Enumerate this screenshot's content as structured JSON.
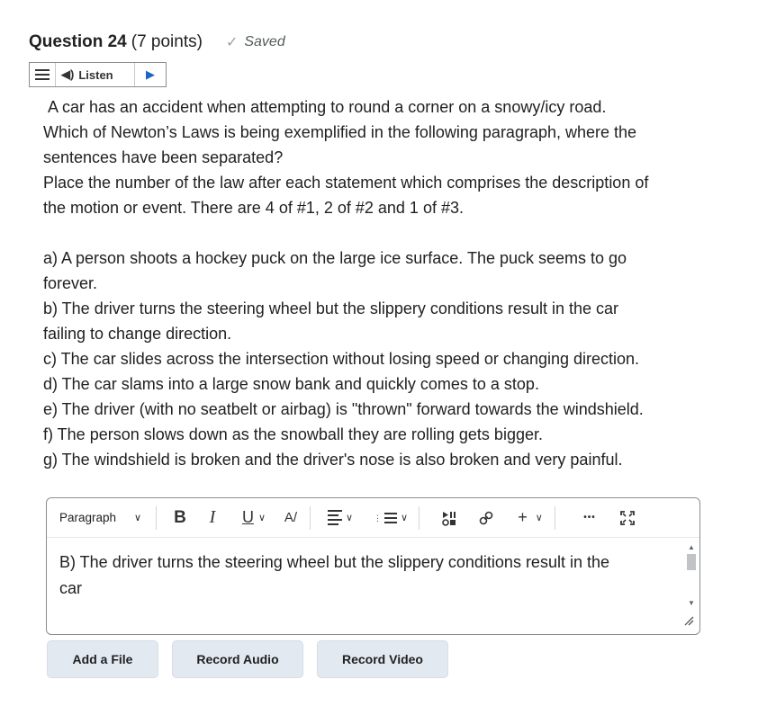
{
  "question": {
    "title": "Question 24",
    "points": "(7 points)",
    "saved_label": "Saved"
  },
  "listen": {
    "label": "Listen"
  },
  "prompt": {
    "intro": [
      "A car has an accident when attempting to round a corner on a snowy/icy road.",
      "Which of Newton’s Laws is being exemplified in the following paragraph, where the",
      "sentences have been separated?",
      "Place the number of the law after each statement which comprises the description of",
      "the motion or event. There are 4 of #1, 2 of #2 and 1 of #3."
    ],
    "items": [
      "a) A person shoots a hockey puck on the large ice surface. The puck seems to go",
      "forever.",
      "b) The driver turns the steering wheel but the slippery conditions result in the car",
      "failing to change direction.",
      "c) The car slides across the intersection without losing speed or changing direction.",
      "d) The car slams into a large snow bank and quickly comes to a stop.",
      "e) The driver (with no seatbelt or airbag) is \"thrown\" forward towards the windshield.",
      "f) The person slows down as the snowball they are rolling gets bigger.",
      "g) The windshield is broken and the driver's nose is also broken and very painful."
    ]
  },
  "editor": {
    "format_select": "Paragraph",
    "bold_label": "B",
    "italic_label": "I",
    "underline_label": "U",
    "plus_label": "+",
    "more_label": "•••",
    "content_lines": [
      "B) The driver turns the steering wheel but the slippery conditions result in the",
      "car"
    ],
    "icons": {
      "dropdown": "chevron-down-icon",
      "text_style": "text-style-icon",
      "align": "align-icon",
      "list": "list-icon",
      "media": "insert-media-icon",
      "link": "link-icon",
      "fullscreen": "fullscreen-icon",
      "resize": "resize-handle-icon"
    }
  },
  "actions": {
    "add_file": "Add a File",
    "record_audio": "Record Audio",
    "record_video": "Record Video"
  }
}
